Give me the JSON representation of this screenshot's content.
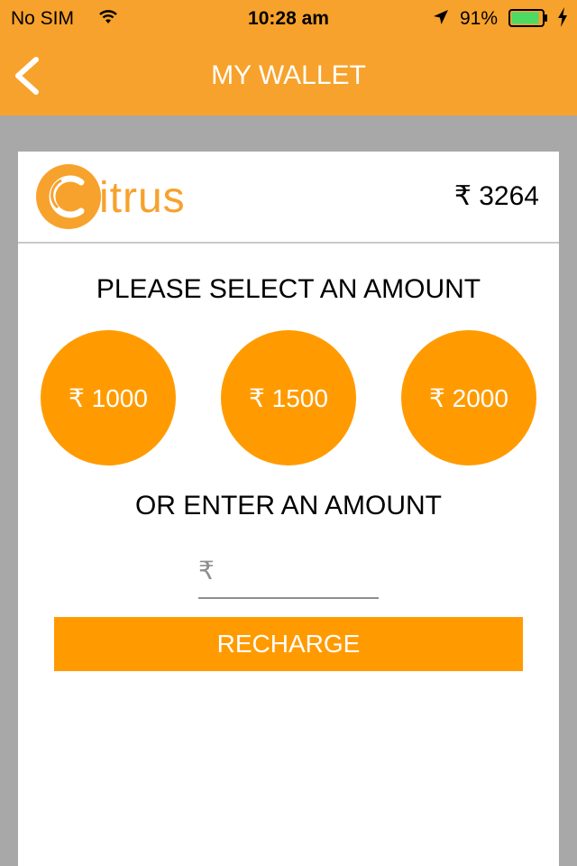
{
  "status_bar": {
    "carrier": "No SIM",
    "time": "10:28 am",
    "battery_percent": "91%",
    "battery_level": 0.91,
    "icons": [
      "wifi-icon",
      "location-arrow-icon",
      "battery-icon",
      "charging-bolt-icon"
    ]
  },
  "nav": {
    "title": "MY WALLET",
    "back_icon": "chevron-left-icon"
  },
  "wallet": {
    "logo_text": "itrus",
    "logo_full": "Citrus",
    "balance": "₹ 3264"
  },
  "select_prompt": "PLEASE SELECT AN AMOUNT",
  "amounts": [
    {
      "label": "₹ 1000"
    },
    {
      "label": "₹ 1500"
    },
    {
      "label": "₹ 2000"
    }
  ],
  "enter_prompt": "OR ENTER AN AMOUNT",
  "amount_input": {
    "prefix": "₹",
    "value": "",
    "placeholder": ""
  },
  "recharge_label": "RECHARGE",
  "colors": {
    "header_orange": "#f7a22c",
    "button_orange": "#ff9b00",
    "background_gray": "#a8a8a8",
    "battery_green": "#4cd964"
  }
}
